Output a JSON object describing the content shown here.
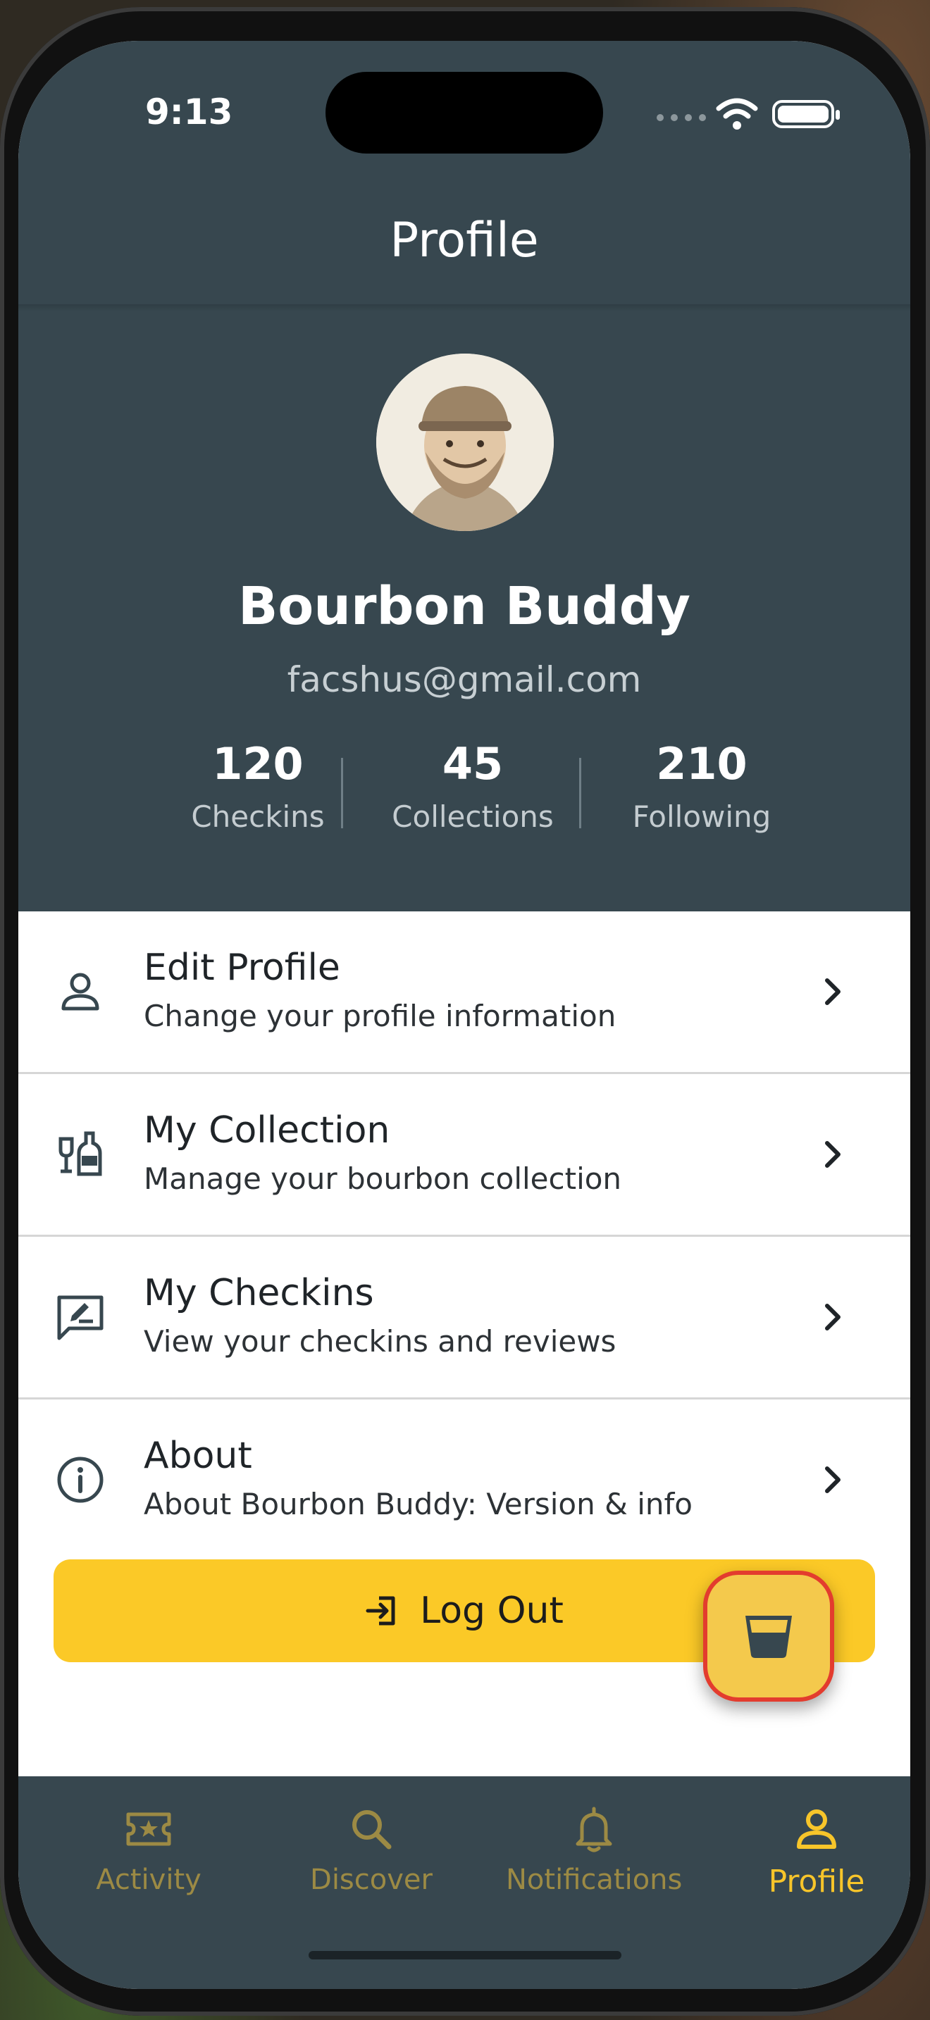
{
  "status": {
    "time": "9:13"
  },
  "header": {
    "title": "Profile"
  },
  "profile": {
    "name": "Bourbon Buddy",
    "email": "facshus@gmail.com",
    "stats": [
      {
        "value": "120",
        "label": "Checkins"
      },
      {
        "value": "45",
        "label": "Collections"
      },
      {
        "value": "210",
        "label": "Following"
      }
    ]
  },
  "menu": {
    "items": [
      {
        "title": "Edit Profile",
        "subtitle": "Change your profile information",
        "icon": "person-icon"
      },
      {
        "title": "My Collection",
        "subtitle": "Manage your bourbon collection",
        "icon": "bottles-icon"
      },
      {
        "title": "My Checkins",
        "subtitle": "View your checkins and reviews",
        "icon": "review-icon"
      },
      {
        "title": "About",
        "subtitle": "About Bourbon Buddy: Version & info",
        "icon": "info-icon"
      }
    ]
  },
  "logout": {
    "label": "Log Out",
    "icon": "logout-icon"
  },
  "fab": {
    "icon": "glass-icon"
  },
  "tabs": [
    {
      "label": "Activity",
      "icon": "ticket-star-icon",
      "active": false
    },
    {
      "label": "Discover",
      "icon": "search-icon",
      "active": false
    },
    {
      "label": "Notifications",
      "icon": "bell-icon",
      "active": false
    },
    {
      "label": "Profile",
      "icon": "person-icon",
      "active": true
    }
  ],
  "colors": {
    "header_bg": "#37474f",
    "accent": "#fbc927",
    "fab_border": "#e33c2e",
    "tab_active": "#f7c52a",
    "tab_inactive": "#9c8a44"
  }
}
